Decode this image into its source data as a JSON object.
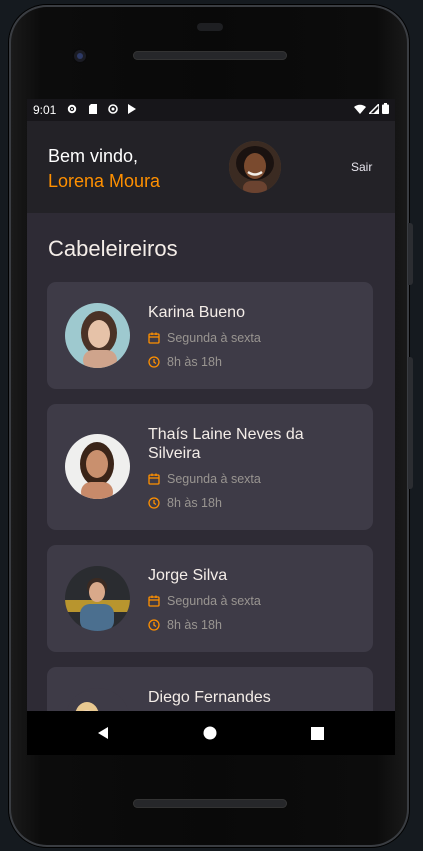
{
  "status_bar": {
    "time": "9:01"
  },
  "header": {
    "greeting": "Bem vindo,",
    "user_name": "Lorena Moura",
    "logout_label": "Sair"
  },
  "section": {
    "title": "Cabeleireiros"
  },
  "providers": [
    {
      "name": "Karina Bueno",
      "days": "Segunda à sexta",
      "hours": "8h às 18h"
    },
    {
      "name": "Thaís Laine Neves da Silveira",
      "days": "Segunda à sexta",
      "hours": "8h às 18h"
    },
    {
      "name": "Jorge Silva",
      "days": "Segunda à sexta",
      "hours": "8h às 18h"
    },
    {
      "name": "Diego Fernandes"
    }
  ],
  "colors": {
    "accent": "#ff9000",
    "card_bg": "#3e3b47",
    "screen_bg": "#2e2b35",
    "header_bg": "#232227"
  }
}
